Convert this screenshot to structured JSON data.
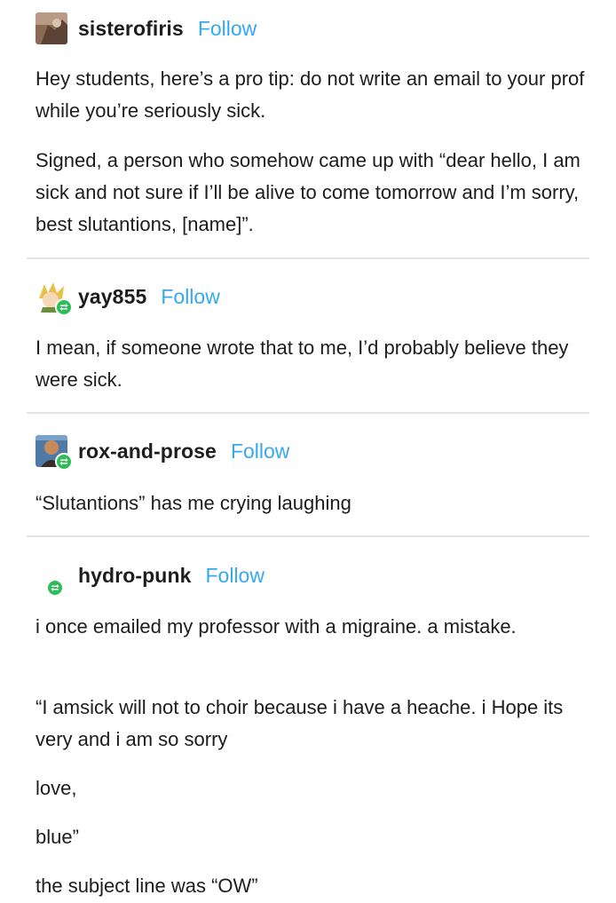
{
  "posts": [
    {
      "username": "sisterofiris",
      "follow_label": "Follow",
      "avatar": "photo-avatar",
      "reblog": false,
      "paragraphs": [
        "Hey students, here’s a pro tip: do not write an email to your prof while you’re seriously sick.",
        "Signed, a person who somehow came up with “dear hello, I am sick and not sure if I’ll be alive to come tomorrow and I’m sorry, best slutantions, [name]”."
      ]
    },
    {
      "username": "yay855",
      "follow_label": "Follow",
      "avatar": "illustrated-avatar",
      "reblog": true,
      "paragraphs": [
        "I mean, if someone wrote that to me, I’d probably believe they were sick."
      ]
    },
    {
      "username": "rox-and-prose",
      "follow_label": "Follow",
      "avatar": "photo-avatar",
      "reblog": true,
      "paragraphs": [
        "“Slutantions” has me crying laughing"
      ]
    },
    {
      "username": "hydro-punk",
      "follow_label": "Follow",
      "avatar": "reblog-icon",
      "reblog": true,
      "paragraphs": [
        "i once emailed my professor with a migraine. a mistake.",
        "“I amsick will not to choir because i have a heache. i Hope its very and i am so sorry",
        "love,",
        "blue”",
        "the subject line was “OW”"
      ]
    }
  ],
  "colors": {
    "follow": "#35a8f0",
    "reblog_badge": "#2ebd59",
    "divider": "#e4e4e4",
    "text": "#1d1d1d"
  }
}
